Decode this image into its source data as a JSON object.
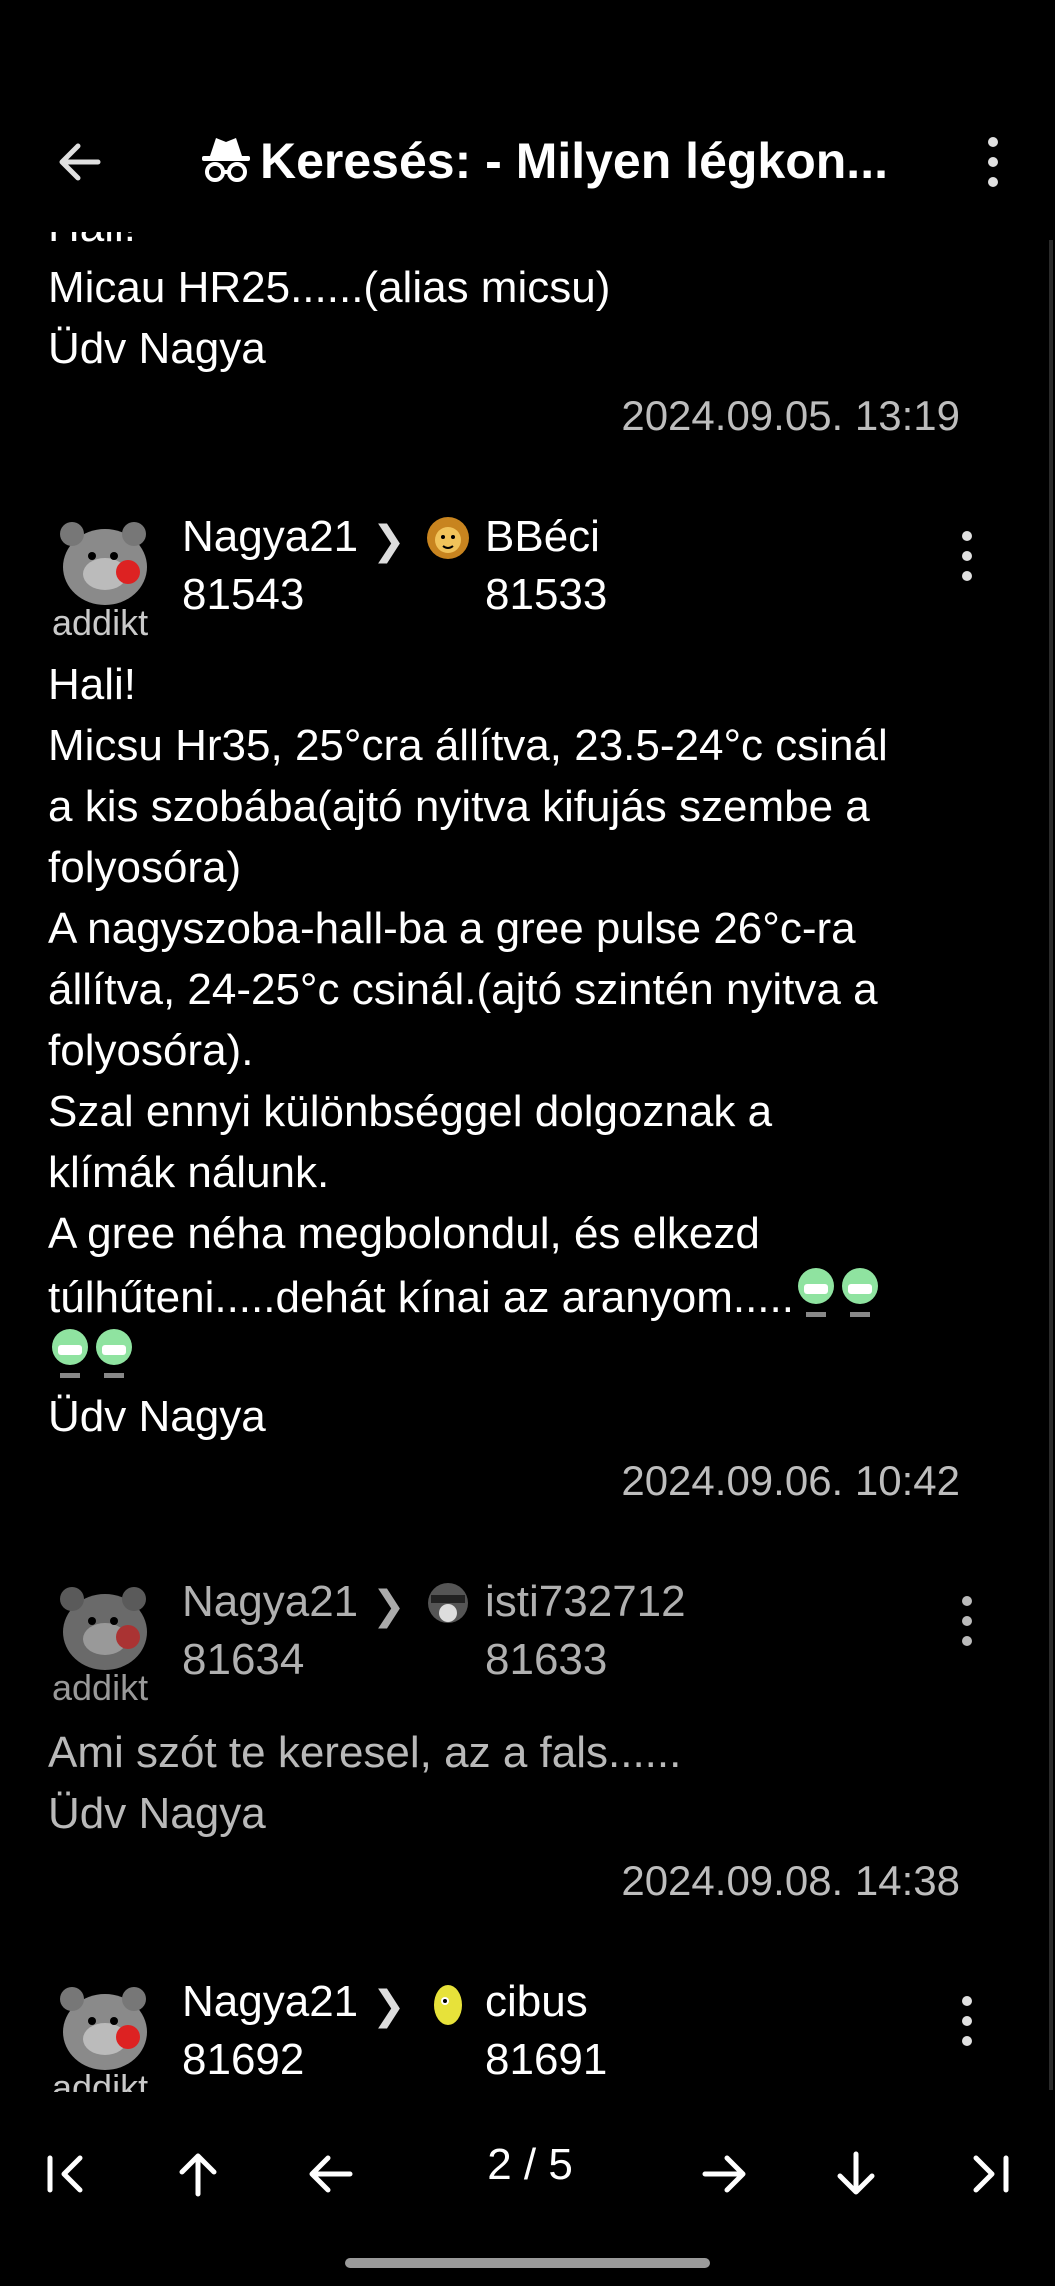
{
  "header": {
    "title": "Keresés: - Milyen légkon...",
    "back_icon": "arrow-left-icon",
    "incognito_icon": "incognito-icon",
    "menu_icon": "more-vert-icon"
  },
  "posts": [
    {
      "partial_top": "Hali!",
      "body_lines": [
        "Micau HR25......(alias micsu)",
        "Üdv Nagya"
      ],
      "date": "2024.09.05. 13:19"
    },
    {
      "author": "Nagya21",
      "author_no": "81543",
      "rank": "addikt",
      "reply_to": "BBéci",
      "reply_no": "81533",
      "body_lines": [
        "Hali!",
        "Micsu Hr35, 25°cra állítva, 23.5-24°c csinál",
        "a kis szobába(ajtó nyitva kifujás szembe a",
        "folyosóra)",
        "A nagyszoba-hall-ba a gree pulse 26°c-ra",
        "állítva, 24-25°c csinál.(ajtó szintén nyitva a",
        "folyosóra).",
        "Szal ennyi különbséggel dolgoznak a",
        "klímák nálunk.",
        "A gree néha megbolondul, és elkezd",
        "túlhűteni.....dehát kínai az aranyom.....",
        "",
        "Üdv Nagya"
      ],
      "date": "2024.09.06. 10:42"
    },
    {
      "author": "Nagya21",
      "author_no": "81634",
      "rank": "addikt",
      "reply_to": "isti732712",
      "reply_no": "81633",
      "body_lines": [
        "Ami szót te keresel, az a fals......",
        "Üdv Nagya"
      ],
      "date": "2024.09.08. 14:38"
    },
    {
      "author": "Nagya21",
      "author_no": "81692",
      "rank": "addikt",
      "reply_to": "cibus",
      "reply_no": "81691"
    }
  ],
  "bottom_nav": {
    "page": "2 / 5",
    "icons": [
      "first-page-icon",
      "arrow-up-icon",
      "arrow-left-icon",
      "arrow-right-icon",
      "arrow-down-icon",
      "last-page-icon"
    ]
  }
}
